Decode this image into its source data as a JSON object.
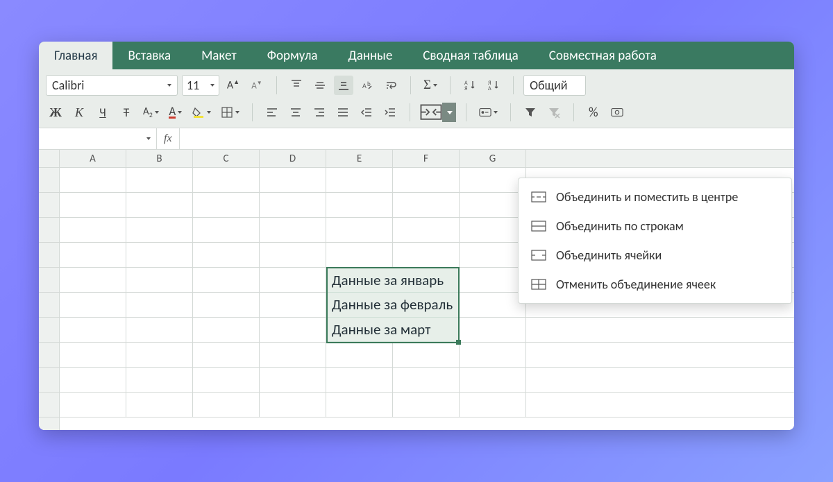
{
  "tabs": [
    "Главная",
    "Вставка",
    "Макет",
    "Формула",
    "Данные",
    "Сводная таблица",
    "Совместная работа"
  ],
  "active_tab_index": 0,
  "toolbar": {
    "font_name": "Calibri",
    "font_size": "11",
    "bold": "Ж",
    "italic": "К",
    "underline": "Ч",
    "strike": "Т",
    "subscript": "A₂",
    "number_format_label": "Общий",
    "percent": "%"
  },
  "columns": [
    "A",
    "B",
    "C",
    "D",
    "E",
    "F",
    "G"
  ],
  "row_count": 10,
  "selection": {
    "rows": [
      "Данные за январь",
      "Данные за февраль",
      "Данные за март"
    ]
  },
  "merge_menu": [
    "Объединить и поместить в центре",
    "Объединить по строкам",
    "Объединить ячейки",
    "Отменить объединение ячеек"
  ],
  "formula_bar": {
    "fx_label": "fx",
    "value": ""
  }
}
